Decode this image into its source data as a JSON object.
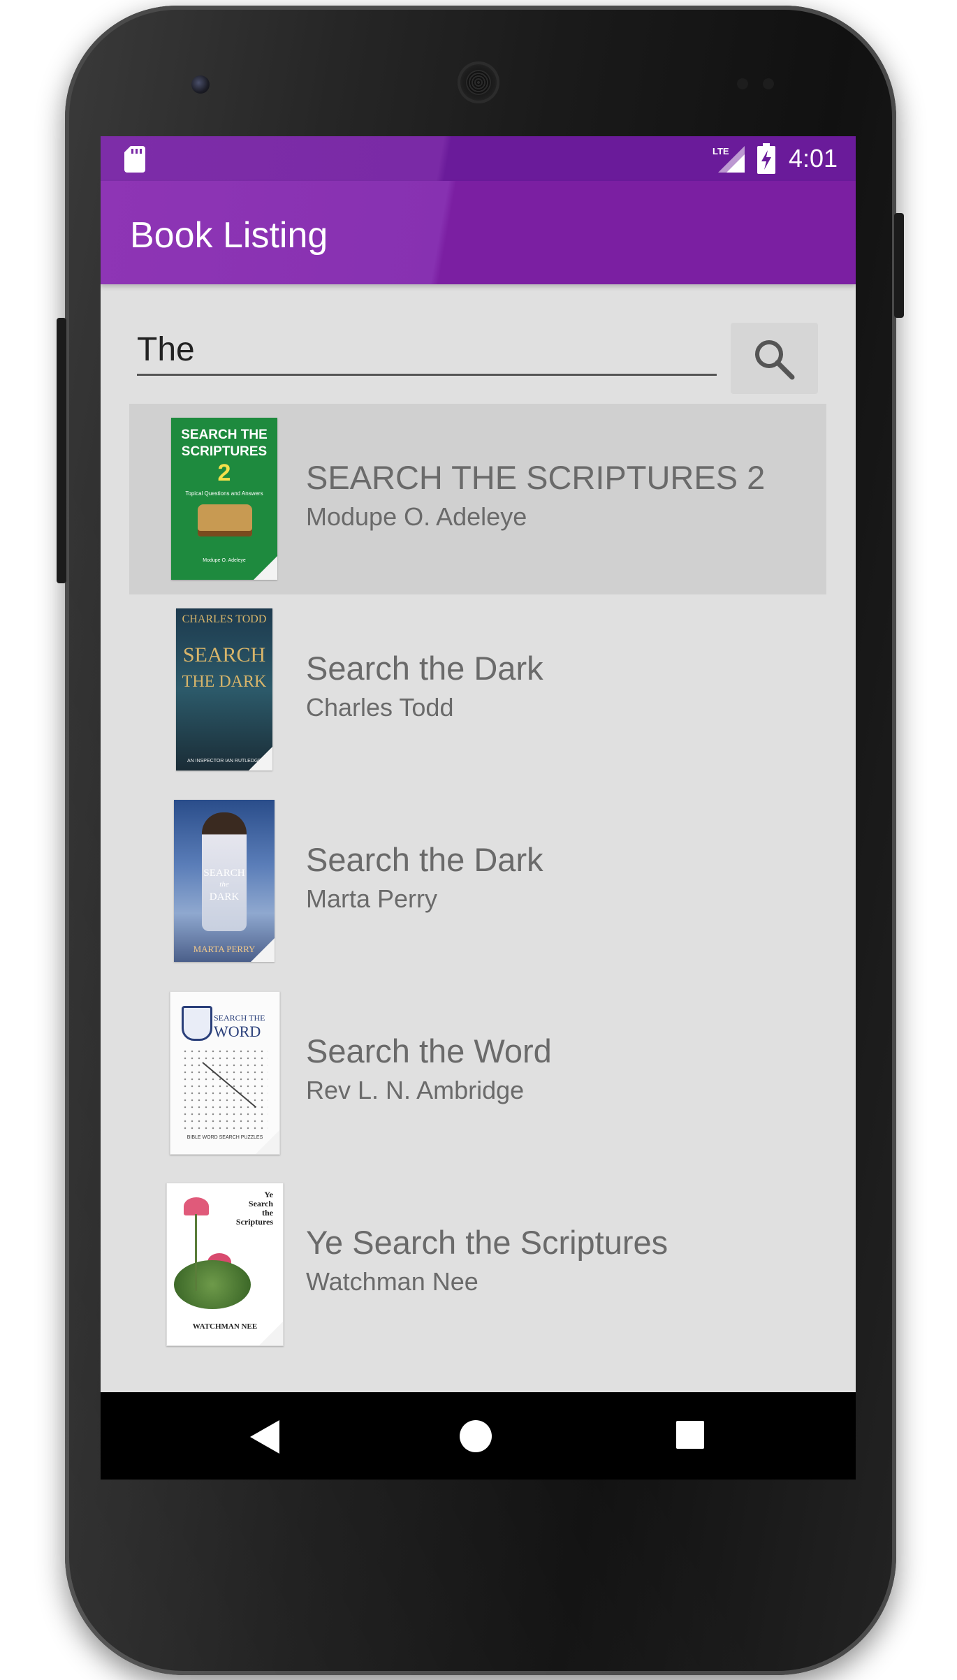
{
  "status_bar": {
    "time": "4:01",
    "icons": [
      "sd-card-icon",
      "lte-signal-icon",
      "battery-charging-icon"
    ]
  },
  "toolbar": {
    "title": "Book Listing"
  },
  "search": {
    "value": "The",
    "button_icon": "search-icon"
  },
  "books": [
    {
      "title": "SEARCH THE SCRIPTURES 2",
      "author": "Modupe O. Adeleye",
      "selected": true,
      "cover": {
        "line1": "SEARCH THE",
        "line2": "SCRIPTURES",
        "line3": "2",
        "line4": "Topical Questions and Answers",
        "line5": "Modupe O. Adeleye"
      }
    },
    {
      "title": "Search the Dark",
      "author": "Charles Todd",
      "selected": false,
      "cover": {
        "line1": "CHARLES TODD",
        "line2": "SEARCH",
        "line3": "THE DARK",
        "line4": "AN INSPECTOR IAN RUTLEDGE"
      }
    },
    {
      "title": "Search the Dark",
      "author": "Marta Perry",
      "selected": false,
      "cover": {
        "line1": "SEARCH",
        "line2": "the",
        "line3": "DARK",
        "line4": "MARTA PERRY"
      }
    },
    {
      "title": "Search the Word",
      "author": "Rev L. N. Ambridge",
      "selected": false,
      "cover": {
        "line1": "SEARCH THE",
        "line2": "WORD",
        "line3": "BIBLE WORD SEARCH PUZZLES"
      }
    },
    {
      "title": "Ye Search the Scriptures",
      "author": "Watchman Nee",
      "selected": false,
      "cover": {
        "line1": "Ye",
        "line2": "Search",
        "line3": "the",
        "line4": "Scriptures",
        "line5": "WATCHMAN NEE"
      }
    }
  ],
  "nav_bar": {
    "icons": [
      "back-icon",
      "home-icon",
      "recents-icon"
    ]
  },
  "colors": {
    "status_bar": "#6a1b9a",
    "toolbar": "#7b1fa2",
    "background": "#e0e0e0",
    "selected_row": "#d0d0d0"
  }
}
